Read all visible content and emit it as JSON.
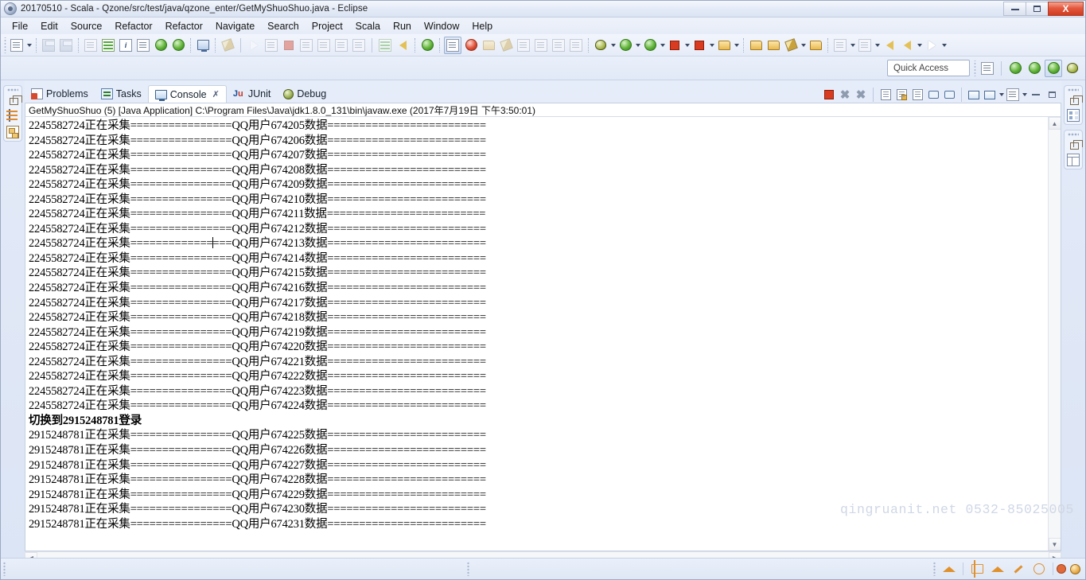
{
  "window": {
    "title": "20170510 - Scala - Qzone/src/test/java/qzone_enter/GetMyShuoShuo.java - Eclipse",
    "app_icon": "eclipse-icon",
    "minimize_label": "Minimize",
    "restore_label": "Restore",
    "close_label": "X"
  },
  "menu": {
    "items": [
      {
        "label": "File"
      },
      {
        "label": "Edit"
      },
      {
        "label": "Source"
      },
      {
        "label": "Refactor"
      },
      {
        "label": "Refactor"
      },
      {
        "label": "Navigate"
      },
      {
        "label": "Search"
      },
      {
        "label": "Project"
      },
      {
        "label": "Scala"
      },
      {
        "label": "Run"
      },
      {
        "label": "Window"
      },
      {
        "label": "Help"
      }
    ]
  },
  "toolbar": {
    "icons": [
      "new-document-icon",
      "new-dropdown-arrow",
      "save-icon",
      "save-all-icon",
      "link-icon",
      "green-table-icon",
      "info-icon",
      "outline-doc-icon",
      "run-last-tool-icon",
      "debug-last-tool-icon",
      "console-icon",
      "skip-breakpoints-icon",
      "resume-icon",
      "suspend-icon",
      "terminate-icon",
      "step-into-icon",
      "step-over-icon",
      "step-return-icon",
      "drop-to-frame-icon",
      "formatter-icon",
      "scala-icon",
      "toggle-mark-occurrences-icon",
      "new-scala-project-icon",
      "search-icon",
      "annotation-icon",
      "eraser-icon",
      "next-annotation-icon",
      "build-icon",
      "open-type-icon",
      "show-whitespace-icon",
      "debug-icon",
      "debug-dropdown-arrow",
      "run-icon",
      "run-dropdown-arrow",
      "run-configurations-icon",
      "run-config-dropdown-arrow",
      "stop-icon",
      "stop-dropdown-arrow",
      "external-tools-icon",
      "external-tools-dropdown-arrow",
      "open-package-icon",
      "open-folder-icon",
      "open-file-icon",
      "file-dropdown-arrow",
      "open-resource-icon",
      "previous-edit-icon",
      "prev-dropdown-arrow",
      "next-edit-icon",
      "next-dropdown-arrow",
      "back-icon",
      "back-arrow-icon",
      "back-dropdown-arrow",
      "forward-icon",
      "forward-dropdown-arrow"
    ]
  },
  "quick_access": {
    "placeholder": "Quick Access",
    "value": "",
    "perspective_buttons": [
      "open-perspective-icon",
      "java-browsing-perspective-icon",
      "java-perspective-icon",
      "java-ee-perspective-icon",
      "debug-perspective-icon"
    ]
  },
  "left_fastview": {
    "groups": [
      {
        "icons": [
          "restore-icon",
          "package-explorer-icon",
          "hierarchy-icon"
        ]
      }
    ]
  },
  "right_fastview": {
    "groups": [
      {
        "icons": [
          "restore-icon",
          "outline-view-icon"
        ]
      },
      {
        "icons": [
          "restore-icon",
          "task-list-icon"
        ]
      }
    ]
  },
  "tabs": [
    {
      "label": "Problems",
      "icon": "problems-icon",
      "active": false,
      "closeable": false
    },
    {
      "label": "Tasks",
      "icon": "tasks-icon",
      "active": false,
      "closeable": false
    },
    {
      "label": "Console",
      "icon": "console-icon",
      "active": true,
      "closeable": true,
      "close_glyph": "✗"
    },
    {
      "label": "JUnit",
      "icon": "junit-icon",
      "active": false,
      "closeable": false
    },
    {
      "label": "Debug",
      "icon": "debug-icon",
      "active": false,
      "closeable": false
    }
  ],
  "console_toolbar": {
    "icons": [
      "terminate-icon",
      "remove-launch-icon",
      "remove-all-terminated-icon",
      "clear-console-icon",
      "scroll-lock-icon",
      "word-wrap-icon",
      "show-console-on-output-icon",
      "pin-console-icon",
      "display-selected-console-icon",
      "open-console-dropdown-arrow",
      "new-console-view-icon",
      "new-console-dropdown-arrow",
      "minimize-view-icon",
      "maximize-view-icon"
    ]
  },
  "console": {
    "header": "GetMyShuoShuo (5) [Java Application] C:\\Program Files\\Java\\jdk1.8.0_131\\bin\\javaw.exe (2017年7月19日 下午3:50:01)",
    "lines": [
      {
        "text": "2245582724正在采集================QQ用户674205数据========================="
      },
      {
        "text": "2245582724正在采集================QQ用户674206数据========================="
      },
      {
        "text": "2245582724正在采集================QQ用户674207数据========================="
      },
      {
        "text": "2245582724正在采集================QQ用户674208数据========================="
      },
      {
        "text": "2245582724正在采集================QQ用户674209数据========================="
      },
      {
        "text": "2245582724正在采集================QQ用户674210数据========================="
      },
      {
        "text": "2245582724正在采集================QQ用户674211数据========================="
      },
      {
        "text": "2245582724正在采集================QQ用户674212数据========================="
      },
      {
        "text": "2245582724正在采集================QQ用户674213数据=========================",
        "caret_after": 27
      },
      {
        "text": "2245582724正在采集================QQ用户674214数据========================="
      },
      {
        "text": "2245582724正在采集================QQ用户674215数据========================="
      },
      {
        "text": "2245582724正在采集================QQ用户674216数据========================="
      },
      {
        "text": "2245582724正在采集================QQ用户674217数据========================="
      },
      {
        "text": "2245582724正在采集================QQ用户674218数据========================="
      },
      {
        "text": "2245582724正在采集================QQ用户674219数据========================="
      },
      {
        "text": "2245582724正在采集================QQ用户674220数据========================="
      },
      {
        "text": "2245582724正在采集================QQ用户674221数据========================="
      },
      {
        "text": "2245582724正在采集================QQ用户674222数据========================="
      },
      {
        "text": "2245582724正在采集================QQ用户674223数据========================="
      },
      {
        "text": "2245582724正在采集================QQ用户674224数据========================="
      },
      {
        "text": "切换到2915248781登录",
        "bold": true
      },
      {
        "text": "2915248781正在采集================QQ用户674225数据========================="
      },
      {
        "text": "2915248781正在采集================QQ用户674226数据========================="
      },
      {
        "text": "2915248781正在采集================QQ用户674227数据========================="
      },
      {
        "text": "2915248781正在采集================QQ用户674228数据========================="
      },
      {
        "text": "2915248781正在采集================QQ用户674229数据========================="
      },
      {
        "text": "2915248781正在采集================QQ用户674230数据========================="
      },
      {
        "text": "2915248781正在采集================QQ用户674231数据========================="
      }
    ],
    "vscroll_up": "▲",
    "vscroll_down": "▼",
    "hscroll_left": "◀",
    "hscroll_right": "▶"
  },
  "watermark": "qingruanit.net  0532-85025005",
  "statusbar": {
    "right_icons": [
      "help-search-icon",
      "book-icon",
      "graduation-cap-icon",
      "pencil-icon",
      "home-icon",
      "error-icon",
      "warning-icon"
    ]
  },
  "colors": {
    "accent": "#3a6ea5",
    "chrome": "#e3eaf7",
    "console_bg": "#ffffff",
    "text": "#000000",
    "watermark": "#cfd7e6",
    "close_red": "#cf3b20"
  }
}
